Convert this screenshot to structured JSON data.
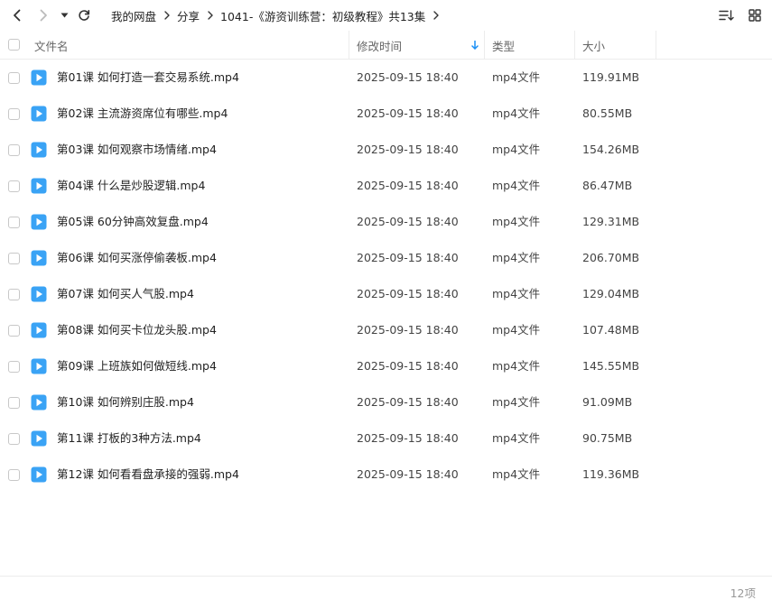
{
  "breadcrumb": {
    "items": [
      "我的网盘",
      "分享",
      "1041-《游资训练营：初级教程》共13集"
    ]
  },
  "header": {
    "name": "文件名",
    "modified": "修改时间",
    "type": "类型",
    "size": "大小"
  },
  "icons": {
    "back": "chevron-left-icon",
    "forward": "chevron-right-icon",
    "history": "caret-down-icon",
    "refresh": "refresh-icon",
    "sort": "sort-list-icon",
    "view": "grid-view-icon",
    "file": "video-file-icon"
  },
  "colors": {
    "accent": "#1a8ff5",
    "video_icon": "#3aa3f5"
  },
  "files": [
    {
      "name": "第01课 如何打造一套交易系统.mp4",
      "modified": "2025-09-15 18:40",
      "type": "mp4文件",
      "size": "119.91MB"
    },
    {
      "name": "第02课 主流游资席位有哪些.mp4",
      "modified": "2025-09-15 18:40",
      "type": "mp4文件",
      "size": "80.55MB"
    },
    {
      "name": "第03课 如何观察市场情绪.mp4",
      "modified": "2025-09-15 18:40",
      "type": "mp4文件",
      "size": "154.26MB"
    },
    {
      "name": "第04课 什么是炒股逻辑.mp4",
      "modified": "2025-09-15 18:40",
      "type": "mp4文件",
      "size": "86.47MB"
    },
    {
      "name": "第05课 60分钟高效复盘.mp4",
      "modified": "2025-09-15 18:40",
      "type": "mp4文件",
      "size": "129.31MB"
    },
    {
      "name": "第06课 如何买涨停偷袭板.mp4",
      "modified": "2025-09-15 18:40",
      "type": "mp4文件",
      "size": "206.70MB"
    },
    {
      "name": "第07课 如何买人气股.mp4",
      "modified": "2025-09-15 18:40",
      "type": "mp4文件",
      "size": "129.04MB"
    },
    {
      "name": "第08课 如何买卡位龙头股.mp4",
      "modified": "2025-09-15 18:40",
      "type": "mp4文件",
      "size": "107.48MB"
    },
    {
      "name": "第09课 上班族如何做短线.mp4",
      "modified": "2025-09-15 18:40",
      "type": "mp4文件",
      "size": "145.55MB"
    },
    {
      "name": "第10课 如何辨别庄股.mp4",
      "modified": "2025-09-15 18:40",
      "type": "mp4文件",
      "size": "91.09MB"
    },
    {
      "name": "第11课 打板的3种方法.mp4",
      "modified": "2025-09-15 18:40",
      "type": "mp4文件",
      "size": "90.75MB"
    },
    {
      "name": "第12课 如何看看盘承接的强弱.mp4",
      "modified": "2025-09-15 18:40",
      "type": "mp4文件",
      "size": "119.36MB"
    }
  ],
  "footer": {
    "count": "12项"
  }
}
